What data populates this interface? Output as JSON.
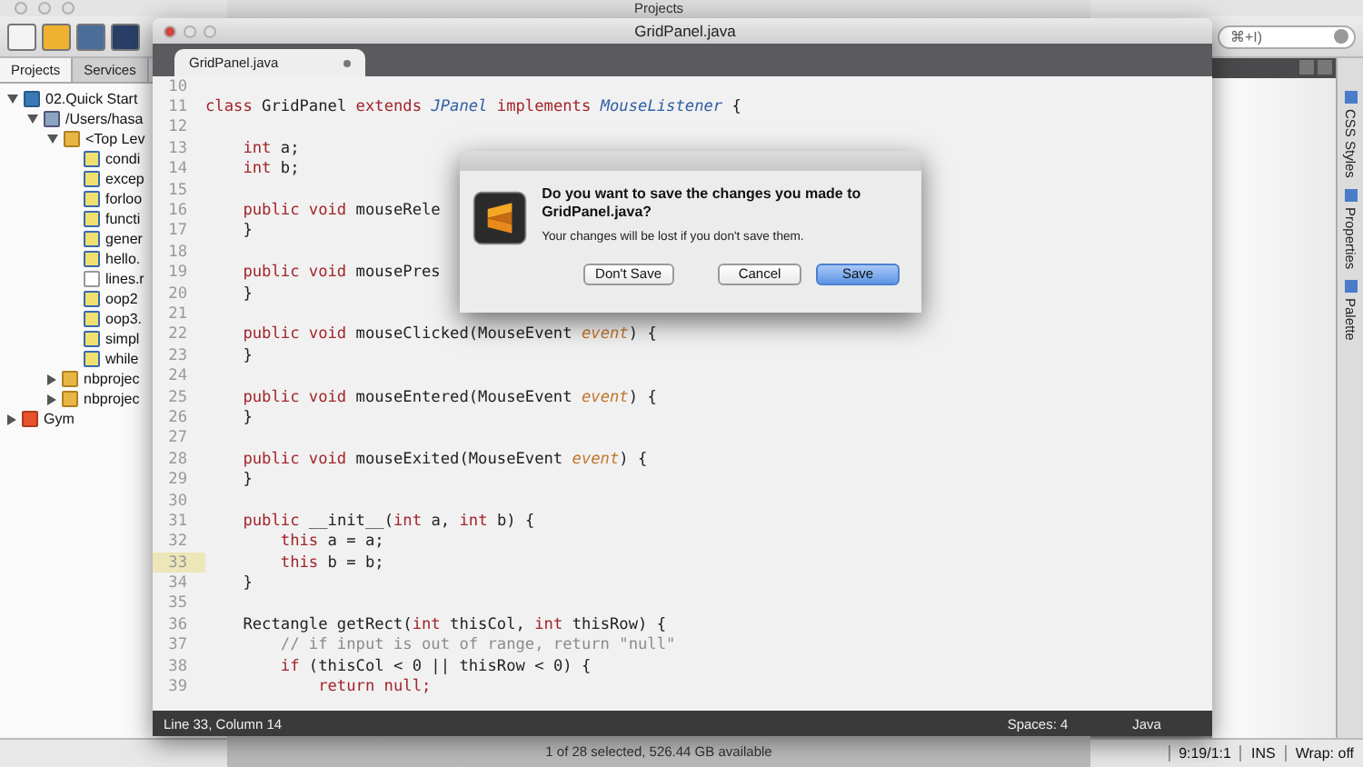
{
  "finder_window": {
    "title": "Projects",
    "status": "1 of 28 selected, 526.44 GB available"
  },
  "ide": {
    "search": {
      "value": "⌘+I)"
    },
    "projects_panel": {
      "tabs": [
        {
          "label": "Projects",
          "selected": true
        },
        {
          "label": "Services",
          "selected": false
        }
      ],
      "tree": [
        {
          "label": "02.Quick Start",
          "kind": "python-project",
          "expanded": true,
          "children": [
            {
              "label": "/Users/hasa",
              "kind": "folder",
              "expanded": true,
              "children": [
                {
                  "label": "<Top Lev",
                  "kind": "package",
                  "expanded": true,
                  "children": [
                    {
                      "label": "condi",
                      "kind": "python"
                    },
                    {
                      "label": "excep",
                      "kind": "python"
                    },
                    {
                      "label": "forloo",
                      "kind": "python"
                    },
                    {
                      "label": "functi",
                      "kind": "python"
                    },
                    {
                      "label": "gener",
                      "kind": "python"
                    },
                    {
                      "label": "hello.",
                      "kind": "python"
                    },
                    {
                      "label": "lines.r",
                      "kind": "text"
                    },
                    {
                      "label": "oop2",
                      "kind": "python"
                    },
                    {
                      "label": "oop3.",
                      "kind": "python"
                    },
                    {
                      "label": "simpl",
                      "kind": "python"
                    },
                    {
                      "label": "while",
                      "kind": "python"
                    }
                  ]
                },
                {
                  "label": "nbprojec",
                  "kind": "package",
                  "expanded": false
                },
                {
                  "label": "nbprojec",
                  "kind": "package",
                  "expanded": false
                }
              ]
            }
          ]
        },
        {
          "label": "Gym",
          "kind": "html-project",
          "expanded": false
        }
      ]
    },
    "side_tabs": [
      "CSS Styles",
      "Properties",
      "Palette"
    ],
    "status_bar": {
      "position": "9:19/1:1",
      "mode": "INS",
      "wrap": "Wrap: off"
    }
  },
  "editor": {
    "title": "GridPanel.java",
    "tabs": [
      {
        "label": "GridPanel.java",
        "selected": true,
        "modified": true
      }
    ],
    "lines": [
      {
        "n": "10",
        "current": false
      },
      {
        "n": "11",
        "current": false,
        "code": [
          {
            "kind": "keyword",
            "text": "class"
          },
          {
            "kind": "plain",
            "text": " GridPanel "
          },
          {
            "kind": "keyword",
            "text": "extends"
          },
          {
            "kind": "type",
            "text": " JPanel"
          },
          {
            "kind": "keyword",
            "text": " implements"
          },
          {
            "kind": "type",
            "text": " MouseListener"
          },
          {
            "kind": "plain",
            "text": " {"
          }
        ]
      },
      {
        "n": "12",
        "current": false
      },
      {
        "n": "13",
        "current": false,
        "code": [
          {
            "kind": "keyword",
            "text": "    int"
          },
          {
            "kind": "plain",
            "text": " a;"
          }
        ]
      },
      {
        "n": "14",
        "current": false,
        "code": [
          {
            "kind": "keyword",
            "text": "    int"
          },
          {
            "kind": "plain",
            "text": " b;"
          }
        ]
      },
      {
        "n": "15",
        "current": false
      },
      {
        "n": "16",
        "current": false,
        "code": [
          {
            "kind": "keyword",
            "text": "    public void"
          },
          {
            "kind": "plain",
            "text": " mouseRele"
          }
        ]
      },
      {
        "n": "17",
        "current": false,
        "code": [
          {
            "kind": "plain",
            "text": "    }"
          }
        ]
      },
      {
        "n": "18",
        "current": false
      },
      {
        "n": "19",
        "current": false,
        "code": [
          {
            "kind": "keyword",
            "text": "    public void"
          },
          {
            "kind": "plain",
            "text": " mousePres"
          }
        ]
      },
      {
        "n": "20",
        "current": false,
        "code": [
          {
            "kind": "plain",
            "text": "    }"
          }
        ]
      },
      {
        "n": "21",
        "current": false
      },
      {
        "n": "22",
        "current": false,
        "code": [
          {
            "kind": "keyword",
            "text": "    public void"
          },
          {
            "kind": "plain",
            "text": " mouseClicked(MouseEvent"
          },
          {
            "kind": "param",
            "text": " event"
          },
          {
            "kind": "plain",
            "text": ") {"
          }
        ]
      },
      {
        "n": "23",
        "current": false,
        "code": [
          {
            "kind": "plain",
            "text": "    }"
          }
        ]
      },
      {
        "n": "24",
        "current": false
      },
      {
        "n": "25",
        "current": false,
        "code": [
          {
            "kind": "keyword",
            "text": "    public void"
          },
          {
            "kind": "plain",
            "text": " mouseEntered(MouseEvent"
          },
          {
            "kind": "param",
            "text": " event"
          },
          {
            "kind": "plain",
            "text": ") {"
          }
        ]
      },
      {
        "n": "26",
        "current": false,
        "code": [
          {
            "kind": "plain",
            "text": "    }"
          }
        ]
      },
      {
        "n": "27",
        "current": false
      },
      {
        "n": "28",
        "current": false,
        "code": [
          {
            "kind": "keyword",
            "text": "    public void"
          },
          {
            "kind": "plain",
            "text": " mouseExited(MouseEvent"
          },
          {
            "kind": "param",
            "text": " event"
          },
          {
            "kind": "plain",
            "text": ") {"
          }
        ]
      },
      {
        "n": "29",
        "current": false,
        "code": [
          {
            "kind": "plain",
            "text": "    }"
          }
        ]
      },
      {
        "n": "30",
        "current": false
      },
      {
        "n": "31",
        "current": false,
        "code": [
          {
            "kind": "keyword",
            "text": "    public"
          },
          {
            "kind": "plain",
            "text": " __init__("
          },
          {
            "kind": "keyword",
            "text": "int"
          },
          {
            "kind": "plain",
            "text": " a, "
          },
          {
            "kind": "keyword",
            "text": "int"
          },
          {
            "kind": "plain",
            "text": " b) {"
          }
        ]
      },
      {
        "n": "32",
        "current": false,
        "code": [
          {
            "kind": "keyword",
            "text": "        this"
          },
          {
            "kind": "plain",
            "text": " a = a;"
          }
        ]
      },
      {
        "n": "33",
        "current": true,
        "code": [
          {
            "kind": "keyword",
            "text": "        this"
          },
          {
            "kind": "plain",
            "text": " b = b;"
          }
        ]
      },
      {
        "n": "34",
        "current": false,
        "code": [
          {
            "kind": "plain",
            "text": "    }"
          }
        ]
      },
      {
        "n": "35",
        "current": false
      },
      {
        "n": "36",
        "current": false,
        "code": [
          {
            "kind": "plain",
            "text": "    Rectangle getRect("
          },
          {
            "kind": "keyword",
            "text": "int"
          },
          {
            "kind": "plain",
            "text": " thisCol, "
          },
          {
            "kind": "keyword",
            "text": "int"
          },
          {
            "kind": "plain",
            "text": " thisRow) {"
          }
        ]
      },
      {
        "n": "37",
        "current": false,
        "code": [
          {
            "kind": "comment",
            "text": "        // if input is out of range, return \"null\""
          }
        ]
      },
      {
        "n": "38",
        "current": false,
        "code": [
          {
            "kind": "keyword",
            "text": "        if"
          },
          {
            "kind": "plain",
            "text": " (thisCol < 0 || thisRow < 0) {"
          }
        ]
      },
      {
        "n": "39",
        "current": false,
        "code": [
          {
            "kind": "keyword",
            "text": "            return null;"
          }
        ]
      }
    ],
    "status": {
      "cursor": "Line 33, Column 14",
      "indent": "Spaces: 4",
      "syntax": "Java"
    }
  },
  "dialog": {
    "message": "Do you want to save the changes you made to GridPanel.java?",
    "detail": "Your changes will be lost if you don't save them.",
    "buttons": [
      {
        "label": "Don't Save",
        "default": false
      },
      {
        "label": "Cancel",
        "default": false
      },
      {
        "label": "Save",
        "default": true
      }
    ]
  }
}
